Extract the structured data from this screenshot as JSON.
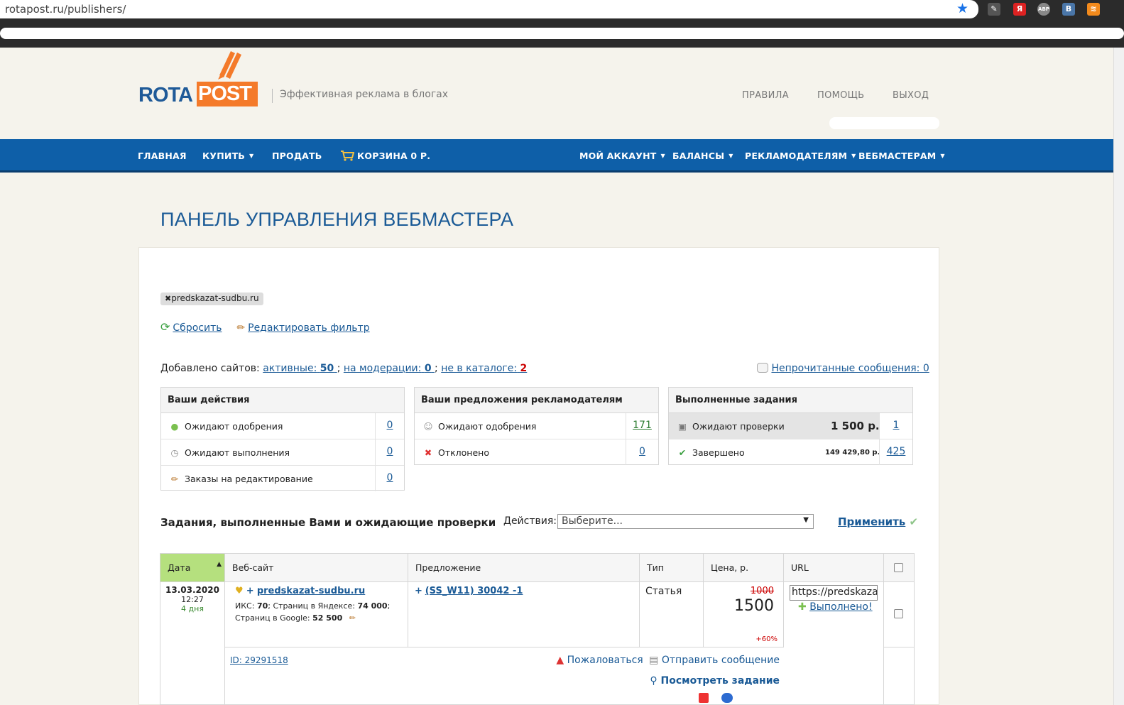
{
  "browser": {
    "url": "rotapost.ru/publishers/",
    "extensions": [
      "pen-icon",
      "yandex-icon",
      "abp-icon",
      "vk-icon",
      "rss-icon"
    ]
  },
  "header": {
    "logo_left": "ROTA",
    "logo_right": "POST",
    "tagline": "Эффективная реклама в блогах",
    "links": [
      "ПРАВИЛА",
      "ПОМОЩЬ",
      "ВЫХОД"
    ]
  },
  "nav": {
    "home": "ГЛАВНАЯ",
    "buy": "КУПИТЬ",
    "sell": "ПРОДАТЬ",
    "cart": "КОРЗИНА 0 Р.",
    "account": "МОЙ АККАУНТ",
    "balances": "БАЛАНСЫ",
    "advertisers": "РЕКЛАМОДАТЕЛЯМ",
    "webmasters": "ВЕБМАСТЕРАМ"
  },
  "page": {
    "title": "ПАНЕЛЬ УПРАВЛЕНИЯ ВЕБМАСТЕРА",
    "filter_chip": "predskazat-sudbu.ru",
    "reset": "Сбросить",
    "edit_filter": "Редактировать фильтр",
    "added_label": "Добавлено сайтов:",
    "active_label": "активные:",
    "active_count": "50",
    "moderation_label": "на модерации:",
    "moderation_count": "0",
    "not_catalog_label": "не в каталоге:",
    "not_catalog_count": "2",
    "unread": "Непрочитанные сообщения: 0"
  },
  "boxes": {
    "actions": {
      "title": "Ваши действия",
      "rows": [
        {
          "label": "Ожидают одобрения",
          "count": "0"
        },
        {
          "label": "Ожидают выполнения",
          "count": "0"
        },
        {
          "label": "Заказы на редактирование",
          "count": "0"
        }
      ]
    },
    "offers": {
      "title": "Ваши предложения рекламодателям",
      "rows": [
        {
          "label": "Ожидают одобрения",
          "count": "171"
        },
        {
          "label": "Отклонено",
          "count": "0"
        }
      ]
    },
    "done": {
      "title": "Выполненные задания",
      "rows": [
        {
          "label": "Ожидают проверки",
          "amount": "1 500 р.",
          "count": "1"
        },
        {
          "label": "Завершено",
          "amount": "149 429,80 р.",
          "count": "425"
        }
      ]
    }
  },
  "tasks": {
    "title": "Задания, выполненные Вами и ожидающие проверки",
    "actions_label": "Действия:",
    "select_value": "Выберите...",
    "apply": "Применить",
    "columns": [
      "Дата",
      "Веб-сайт",
      "Предложение",
      "Тип",
      "Цена, р.",
      "URL"
    ],
    "row": {
      "date": "13.03.2020",
      "time": "12:27",
      "ago": "4 дня",
      "site": "predskazat-sudbu.ru",
      "iks_label": "ИКС:",
      "iks": "70",
      "yandex_label": "Страниц в Яндексе:",
      "yandex": "74 000",
      "google_label": "Страниц в Google:",
      "google": "52 500",
      "offer": "(SS_W11) 30042 -1",
      "type": "Статья",
      "old_price": "1000",
      "price": "1500",
      "markup": "+60%",
      "url_value": "https://predskazat-sudbu.ru",
      "done": "Выполнено!",
      "id": "ID: 29291518",
      "complain": "Пожаловаться",
      "send_message": "Отправить сообщение",
      "view_task": "Посмотреть задание"
    }
  },
  "colors": {
    "nav_bg": "#0e5fa8",
    "brand_blue": "#1f5a98",
    "brand_orange": "#f47a2a",
    "date_header_green": "#b5e07e"
  }
}
